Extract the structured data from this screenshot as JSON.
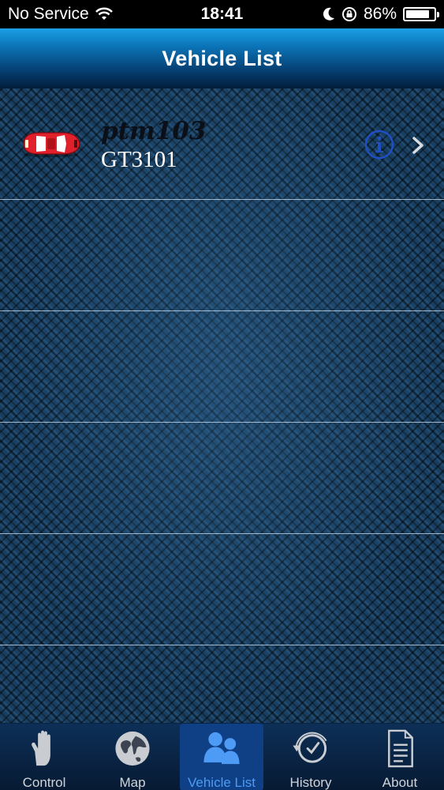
{
  "status_bar": {
    "carrier": "No Service",
    "time": "18:41",
    "battery_percent": "86%",
    "battery_level": 0.86
  },
  "nav": {
    "title": "Vehicle List"
  },
  "vehicles": [
    {
      "name": "ptm103",
      "model": "GT3101"
    }
  ],
  "tabs": [
    {
      "label": "Control",
      "icon": "hand-icon"
    },
    {
      "label": "Map",
      "icon": "globe-icon"
    },
    {
      "label": "Vehicle List",
      "icon": "users-icon",
      "active": true
    },
    {
      "label": "History",
      "icon": "history-clock-icon"
    },
    {
      "label": "About",
      "icon": "document-icon"
    }
  ],
  "colors": {
    "accent": "#4d9bf5",
    "active_tab_bg": "#0f3f84",
    "nav_top": "#1ba0e6",
    "car_red": "#e0202a"
  }
}
